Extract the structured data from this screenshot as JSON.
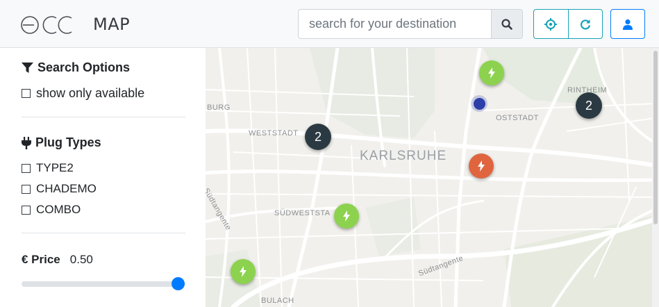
{
  "header": {
    "logo_name": "ecc-logo",
    "app_title": "MAP",
    "search": {
      "placeholder": "search for your destination",
      "value": "",
      "button_icon": "search-icon"
    },
    "locate_icon": "crosshair-icon",
    "refresh_icon": "refresh-icon",
    "profile_icon": "user-icon",
    "accent_color": "#17a2b8",
    "primary_color": "#007bff"
  },
  "sidebar": {
    "search_options": {
      "title": "Search Options",
      "icon": "filter-icon",
      "show_available_label": "show only available",
      "show_available_checked": false
    },
    "plug_types": {
      "title": "Plug Types",
      "icon": "plug-icon",
      "items": [
        {
          "label": "TYPE2",
          "checked": false
        },
        {
          "label": "CHADEMO",
          "checked": false
        },
        {
          "label": "COMBO",
          "checked": false
        }
      ]
    },
    "price": {
      "title": "€ Price",
      "value": "0.50",
      "slider_fraction": 0.98
    }
  },
  "map": {
    "labels": [
      "BURG",
      "WESTSTADT",
      "KARLSRUHE",
      "RINTHEIM",
      "OSTSTADT",
      "SÜDWESTSTA",
      "Südtangente",
      "Südtangente",
      "BULACH"
    ],
    "markers": [
      {
        "type": "charger",
        "status": "available",
        "color": "#8cd24f",
        "icon": "bolt-icon"
      },
      {
        "type": "charger",
        "status": "occupied",
        "color": "#e0653f",
        "icon": "bolt-icon"
      },
      {
        "type": "charger",
        "status": "available",
        "color": "#8cd24f",
        "icon": "bolt-icon"
      },
      {
        "type": "charger",
        "status": "available",
        "color": "#8cd24f",
        "icon": "bolt-icon"
      }
    ],
    "clusters": [
      {
        "count": "2"
      },
      {
        "count": "2"
      }
    ],
    "user_location_color": "#2c3fa8"
  }
}
